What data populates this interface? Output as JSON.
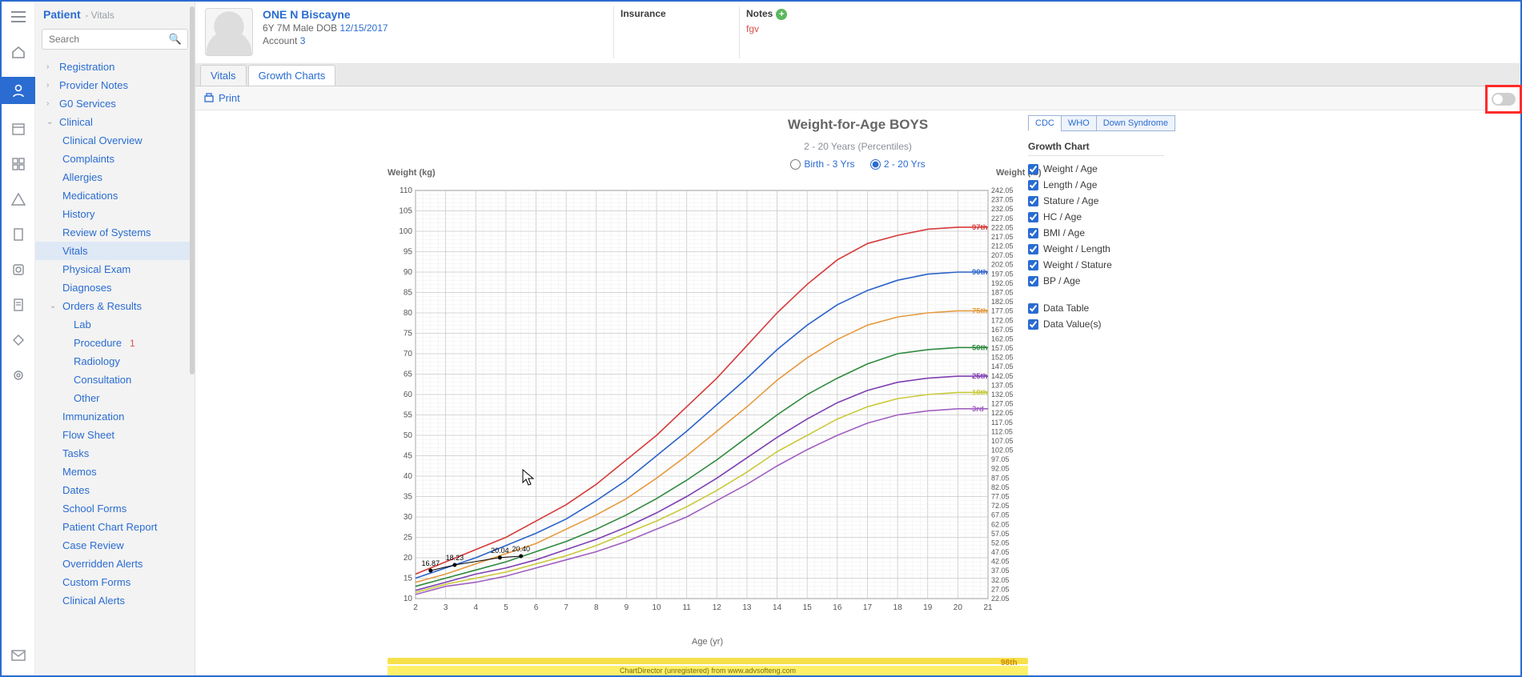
{
  "sidebar_header": {
    "title": "Patient",
    "subtitle": "- Vitals"
  },
  "search": {
    "placeholder": "Search"
  },
  "nav": {
    "registration": "Registration",
    "provider_notes": "Provider Notes",
    "g0_services": "G0 Services",
    "clinical": "Clinical",
    "clinical_overview": "Clinical Overview",
    "complaints": "Complaints",
    "allergies": "Allergies",
    "medications": "Medications",
    "history": "History",
    "review_of_systems": "Review of Systems",
    "vitals": "Vitals",
    "physical_exam": "Physical Exam",
    "diagnoses": "Diagnoses",
    "orders_results": "Orders & Results",
    "lab": "Lab",
    "procedure": "Procedure",
    "procedure_count": "1",
    "radiology": "Radiology",
    "consultation": "Consultation",
    "other": "Other",
    "immunization": "Immunization",
    "flow_sheet": "Flow Sheet",
    "tasks": "Tasks",
    "memos": "Memos",
    "dates": "Dates",
    "school_forms": "School Forms",
    "patient_chart_report": "Patient Chart Report",
    "case_review": "Case Review",
    "overridden_alerts": "Overridden Alerts",
    "custom_forms": "Custom Forms",
    "clinical_alerts": "Clinical Alerts"
  },
  "patient": {
    "name": "ONE N Biscayne",
    "age_sex": "6Y 7M Male",
    "dob_label": "DOB",
    "dob": "12/15/2017",
    "account_label": "Account",
    "account": "3",
    "insurance_label": "Insurance",
    "notes_label": "Notes",
    "notes_value": "fgv"
  },
  "tabs": {
    "vitals": "Vitals",
    "growth": "Growth Charts"
  },
  "toolbar": {
    "print": "Print"
  },
  "chart": {
    "title": "Weight-for-Age BOYS",
    "subtitle": "2 - 20 Years (Percentiles)",
    "r1": "Birth - 3 Yrs",
    "r2": "2 - 20 Yrs",
    "x_label": "Age (yr)",
    "y_label_left": "Weight (kg)",
    "y_label_right": "Weight (lb)"
  },
  "source_tabs": {
    "cdc": "CDC",
    "who": "WHO",
    "downs": "Down Syndrome"
  },
  "opts": {
    "header": "Growth Chart",
    "o1": "Weight / Age",
    "o2": "Length / Age",
    "o3": "Stature / Age",
    "o4": "HC / Age",
    "o5": "BMI / Age",
    "o6": "Weight / Length",
    "o7": "Weight / Stature",
    "o8": "BP / Age",
    "d1": "Data Table",
    "d2": "Data Value(s)"
  },
  "credits": "ChartDirector (unregistered) from www.advsofteng.com",
  "th_label": "98th",
  "percentile_labels": {
    "p97": "97th",
    "p90": "90th",
    "p75": "75th",
    "p50": "50th",
    "p25": "25th",
    "p10": "10th",
    "p3": "3rd"
  },
  "data_values": {
    "v1": "16.87",
    "v2": "18.23",
    "v3": "20.04",
    "v4": "20.40"
  },
  "chart_data": {
    "type": "line",
    "title": "Weight-for-Age BOYS",
    "subtitle": "2 - 20 Years (Percentiles)",
    "xlabel": "Age (yr)",
    "ylabel_left": "Weight (kg)",
    "ylabel_right": "Weight (lb)",
    "xlim": [
      2,
      21
    ],
    "ylim_left": [
      10,
      110
    ],
    "ylim_right": [
      22.05,
      242.05
    ],
    "x_ticks": [
      2,
      3,
      4,
      5,
      6,
      7,
      8,
      9,
      10,
      11,
      12,
      13,
      14,
      15,
      16,
      17,
      18,
      19,
      20,
      21
    ],
    "y_ticks_left": [
      10,
      15,
      20,
      25,
      30,
      35,
      40,
      45,
      50,
      55,
      60,
      65,
      70,
      75,
      80,
      85,
      90,
      95,
      100,
      105,
      110
    ],
    "y_ticks_right": [
      22.05,
      27.05,
      32.05,
      37.05,
      42.05,
      47.05,
      52.05,
      57.05,
      62.05,
      67.05,
      72.05,
      77.05,
      82.05,
      87.05,
      92.05,
      97.05,
      102.05,
      107.05,
      112.05,
      117.05,
      122.05,
      127.05,
      132.05,
      137.05,
      142.05,
      147.05,
      152.05,
      157.05,
      162.05,
      167.05,
      172.05,
      177.05,
      182.05,
      187.05,
      192.05,
      197.05,
      202.05,
      207.05,
      212.05,
      217.05,
      222.05,
      227.05,
      232.05,
      237.05,
      242.05
    ],
    "x": [
      2,
      3,
      4,
      5,
      6,
      7,
      8,
      9,
      10,
      11,
      12,
      13,
      14,
      15,
      16,
      17,
      18,
      19,
      20,
      21
    ],
    "series": [
      {
        "name": "97th",
        "color": "#d63a3a",
        "values": [
          16,
          19,
          22,
          25,
          29,
          33,
          38,
          44,
          50,
          57,
          64,
          72,
          80,
          87,
          93,
          97,
          99,
          100.5,
          101,
          101
        ]
      },
      {
        "name": "90th",
        "color": "#2a62c9",
        "values": [
          15,
          17.5,
          20,
          23,
          26,
          29.5,
          34,
          39,
          45,
          51,
          57.5,
          64,
          71,
          77,
          82,
          85.5,
          88,
          89.5,
          90,
          90
        ]
      },
      {
        "name": "75th",
        "color": "#e59a3e",
        "values": [
          14,
          16,
          18.5,
          21,
          23.5,
          27,
          30.5,
          34.5,
          39.5,
          45,
          51,
          57,
          63.5,
          69,
          73.5,
          77,
          79,
          80,
          80.5,
          80.5
        ]
      },
      {
        "name": "50th",
        "color": "#2f8a3f",
        "values": [
          13,
          15,
          17,
          19,
          21.5,
          24,
          27,
          30.5,
          34.5,
          39,
          44,
          49.5,
          55,
          60,
          64,
          67.5,
          70,
          71,
          71.5,
          71.5
        ]
      },
      {
        "name": "25th",
        "color": "#7e3fb1",
        "values": [
          12,
          14,
          16,
          17.5,
          19.5,
          22,
          24.5,
          27.5,
          31,
          35,
          39.5,
          44.5,
          49.5,
          54,
          58,
          61,
          63,
          64,
          64.5,
          64.5
        ]
      },
      {
        "name": "10th",
        "color": "#c9c93a",
        "values": [
          11.5,
          13.5,
          15,
          16.5,
          18.5,
          20.5,
          23,
          26,
          29,
          32.5,
          36.5,
          41,
          46,
          50,
          54,
          57,
          59,
          60,
          60.5,
          60.5
        ]
      },
      {
        "name": "3rd",
        "color": "#a060c0",
        "values": [
          11,
          13,
          14,
          15.5,
          17.5,
          19.5,
          21.5,
          24,
          27,
          30,
          34,
          38,
          42.5,
          46.5,
          50,
          53,
          55,
          56,
          56.5,
          56.5
        ]
      }
    ],
    "patient_points": {
      "x": [
        2.5,
        3.3,
        4.8,
        5.5
      ],
      "y": [
        16.87,
        18.23,
        20.04,
        20.4
      ],
      "labels": [
        "16.87",
        "18.23",
        "20.04",
        "20.40"
      ]
    }
  }
}
